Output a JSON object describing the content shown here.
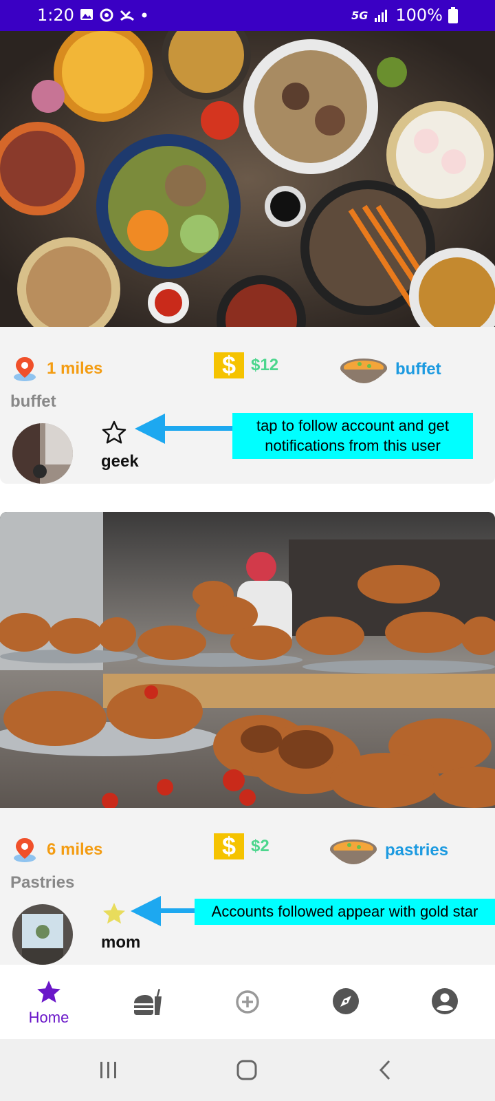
{
  "status_bar": {
    "time": "1:20",
    "network": "5G",
    "battery": "100%"
  },
  "posts": [
    {
      "distance": "1 miles",
      "price": "$12",
      "category": "buffet",
      "title": "buffet",
      "username": "geek",
      "followed": false,
      "callout": "tap to follow account and get notifications from this user"
    },
    {
      "distance": "6 miles",
      "price": "$2",
      "category": "pastries",
      "title": "Pastries",
      "username": "mom",
      "followed": true,
      "callout": "Accounts followed appear with gold star"
    }
  ],
  "bottom_nav": {
    "home_label": "Home",
    "icons": [
      "star-icon",
      "fast-food-icon",
      "add-circle-icon",
      "compass-icon",
      "account-icon"
    ]
  },
  "colors": {
    "status_bar": "#3a00c4",
    "accent": "#6a17c9",
    "distance": "#f39c12",
    "price": "#4cd68d",
    "category": "#1c9ae0",
    "gold_star": "#e8dc5c",
    "callout_bg": "#00ffff",
    "arrow": "#1da8f0"
  }
}
